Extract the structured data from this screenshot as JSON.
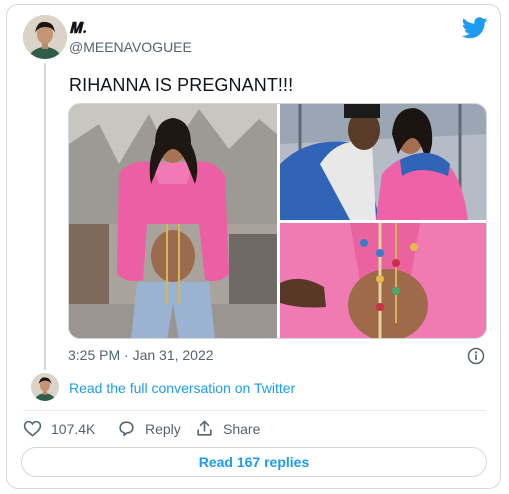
{
  "author": {
    "name": "𝐌.",
    "handle": "@MEENAVOGUEE"
  },
  "tweet": {
    "text": "RIHANNA IS PREGNANT!!!",
    "timestamp": "3:25 PM · Jan 31, 2022"
  },
  "conversation": {
    "link_label": "Read the full conversation on Twitter"
  },
  "actions": {
    "likes_count": "107.4K",
    "reply_label": "Reply",
    "share_label": "Share"
  },
  "replies_button_label": "Read 167 replies",
  "icons": {
    "logo": "twitter-bird-icon",
    "info": "info-icon",
    "like": "heart-icon",
    "reply": "reply-bubble-icon",
    "share": "share-upload-icon"
  },
  "colors": {
    "accent": "#1d9bf0",
    "text_primary": "#0f1419",
    "text_secondary": "#536471",
    "border": "#cfd9de"
  }
}
